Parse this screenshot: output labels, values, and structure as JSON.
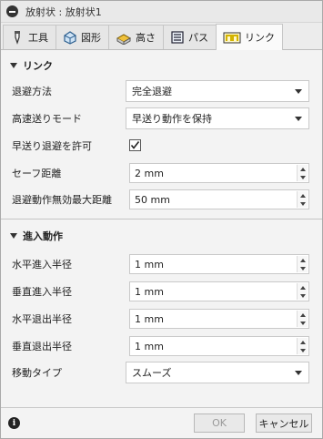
{
  "window": {
    "title": "放射状 : 放射状1"
  },
  "tabs": [
    {
      "label": "工具",
      "icon": "tool-icon"
    },
    {
      "label": "図形",
      "icon": "shape-icon"
    },
    {
      "label": "高さ",
      "icon": "height-icon"
    },
    {
      "label": "パス",
      "icon": "passes-icon"
    },
    {
      "label": "リンク",
      "icon": "linking-icon",
      "active": true
    }
  ],
  "linking": {
    "header": "リンク",
    "retract_policy": {
      "label": "退避方法",
      "value": "完全退避"
    },
    "high_feed_mode": {
      "label": "高速送りモード",
      "value": "早送り動作を保持"
    },
    "allow_rapid_retract": {
      "label": "早送り退避を許可",
      "checked": true
    },
    "safe_distance": {
      "label": "セーフ距離",
      "value": "2 mm"
    },
    "max_stay_down": {
      "label": "退避動作無効最大距離",
      "value": "50 mm"
    }
  },
  "entry": {
    "header": "進入動作",
    "horizontal_lead_in": {
      "label": "水平進入半径",
      "value": "1 mm"
    },
    "vertical_lead_in": {
      "label": "垂直進入半径",
      "value": "1 mm"
    },
    "horizontal_lead_out": {
      "label": "水平退出半径",
      "value": "1 mm"
    },
    "vertical_lead_out": {
      "label": "垂直退出半径",
      "value": "1 mm"
    },
    "transition_type": {
      "label": "移動タイプ",
      "value": "スムーズ"
    }
  },
  "buttons": {
    "ok": "OK",
    "cancel": "キャンセル"
  },
  "colors": {
    "active_tab_icon": "#d4b400",
    "checkbox_check": "#222222"
  }
}
